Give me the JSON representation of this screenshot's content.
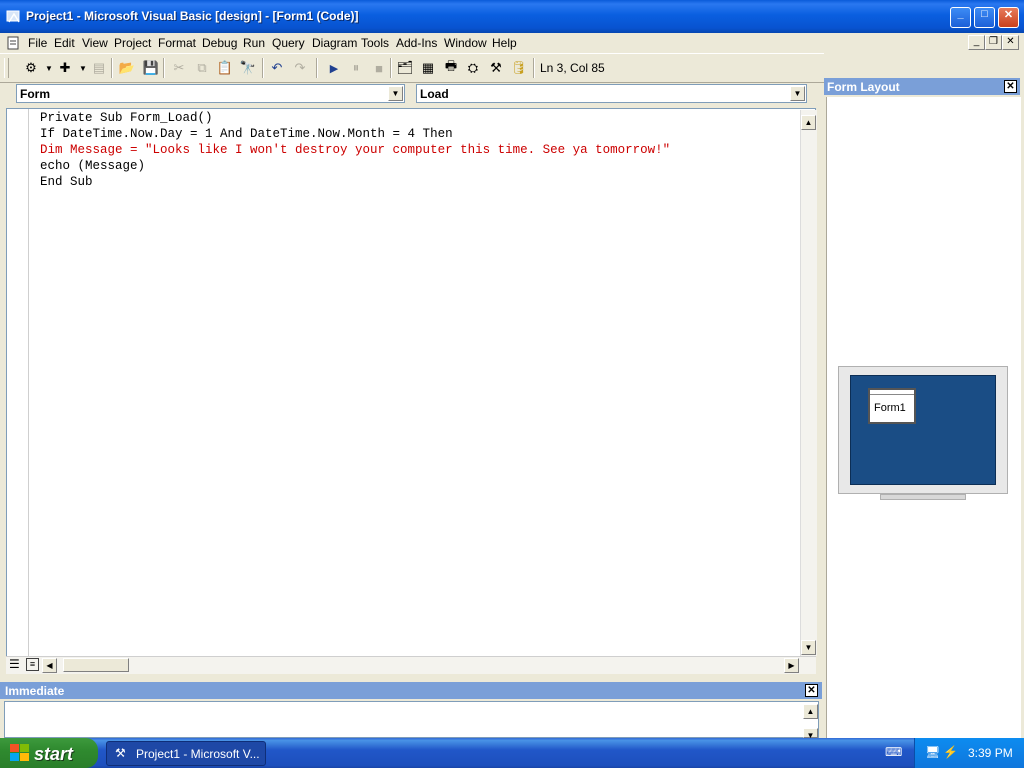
{
  "window": {
    "title": "Project1 - Microsoft Visual Basic [design] - [Form1 (Code)]",
    "minimize_label": "_",
    "maximize_label": "□",
    "close_label": "✕"
  },
  "menu": {
    "items": [
      "File",
      "Edit",
      "View",
      "Project",
      "Format",
      "Debug",
      "Run",
      "Query",
      "Diagram",
      "Tools",
      "Add-Ins",
      "Window",
      "Help"
    ]
  },
  "toolbar": {
    "position_readout": "Ln 3, Col 85"
  },
  "code_window": {
    "object_combo": "Form",
    "procedure_combo": "Load",
    "lines": [
      {
        "text": "Private Sub Form_Load()",
        "color": "#000000"
      },
      {
        "text": "If DateTime.Now.Day = 1 And DateTime.Now.Month = 4 Then",
        "color": "#000000"
      },
      {
        "text": "Dim Message = \"Looks like I won't destroy your computer this time. See ya tomorrow!\"",
        "color": "#cc0000"
      },
      {
        "text": "echo (Message)",
        "color": "#000000"
      },
      {
        "text": "End Sub",
        "color": "#000000"
      }
    ]
  },
  "immediate": {
    "title": "Immediate"
  },
  "form_layout": {
    "title": "Form Layout",
    "form_name": "Form1"
  },
  "taskbar": {
    "start_label": "start",
    "task_label": "Project1 - Microsoft V...",
    "clock": "3:39 PM"
  },
  "colors": {
    "title_bar": "#0a5fe0",
    "panel_header": "#7a9fd8",
    "code_error_red": "#cc0000",
    "start_green": "#2f8a2f"
  }
}
